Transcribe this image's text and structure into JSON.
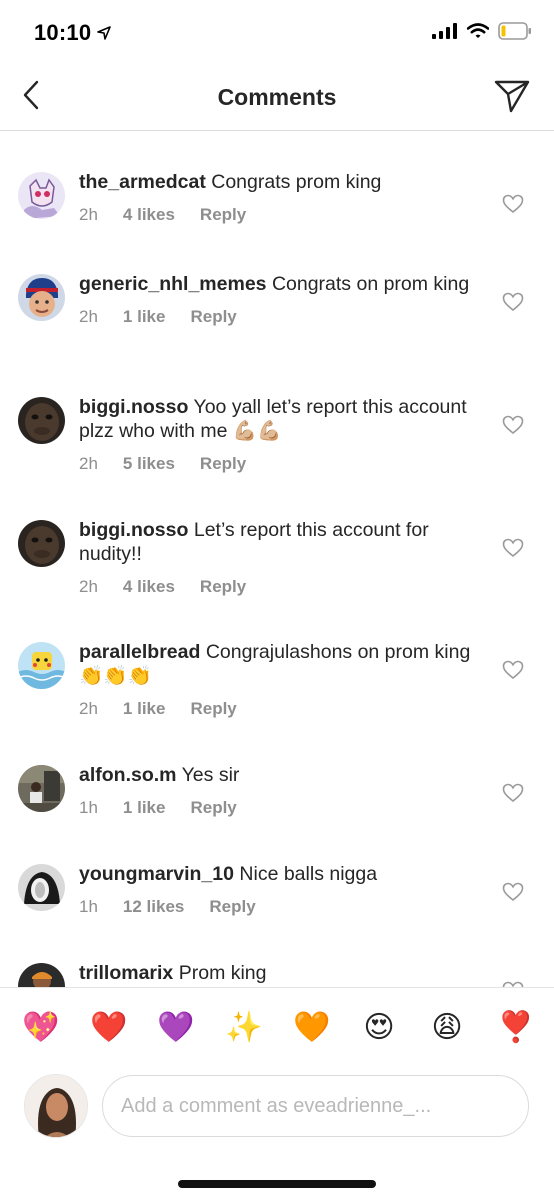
{
  "status_bar": {
    "time": "10:10",
    "icons": [
      "location-arrow-icon",
      "cellular-signal-icon",
      "wifi-icon",
      "battery-icon"
    ]
  },
  "header": {
    "title": "Comments",
    "back_icon": "chevron-left-icon",
    "share_icon": "direct-send-icon"
  },
  "comments": [
    {
      "username": "the_armedcat",
      "text": "Congrats prom king",
      "time": "2h",
      "likes": "4 likes",
      "reply": "Reply"
    },
    {
      "username": "generic_nhl_memes",
      "text": "Congrats on prom king",
      "time": "2h",
      "likes": "1 like",
      "reply": "Reply"
    },
    {
      "username": "biggi.nosso",
      "text": "Yoo yall let’s report this account plzz who with me 💪🏼💪🏼",
      "time": "2h",
      "likes": "5 likes",
      "reply": "Reply"
    },
    {
      "username": "biggi.nosso",
      "text": "Let’s report this account for nudity!!",
      "time": "2h",
      "likes": "4 likes",
      "reply": "Reply"
    },
    {
      "username": "parallelbread",
      "text": "Congrajulashons on prom king 👏👏👏",
      "time": "2h",
      "likes": "1 like",
      "reply": "Reply"
    },
    {
      "username": "alfon.so.m",
      "text": "Yes sir",
      "time": "1h",
      "likes": "1 like",
      "reply": "Reply"
    },
    {
      "username": "youngmarvin_10",
      "text": "Nice balls nigga",
      "time": "1h",
      "likes": "12 likes",
      "reply": "Reply"
    },
    {
      "username": "trillomarix",
      "text": "Prom king",
      "time": "",
      "likes": "",
      "reply": ""
    }
  ],
  "emoji_bar": [
    "💖",
    "❤️",
    "💜",
    "✨",
    "🧡",
    "😍",
    "😩",
    "❣️"
  ],
  "composer": {
    "placeholder": "Add a comment as eveadrienne_..."
  },
  "colors": {
    "text": "#262626",
    "meta": "#8e8e8e",
    "divider": "#dbdbdb",
    "placeholder": "#b8b8b8"
  }
}
